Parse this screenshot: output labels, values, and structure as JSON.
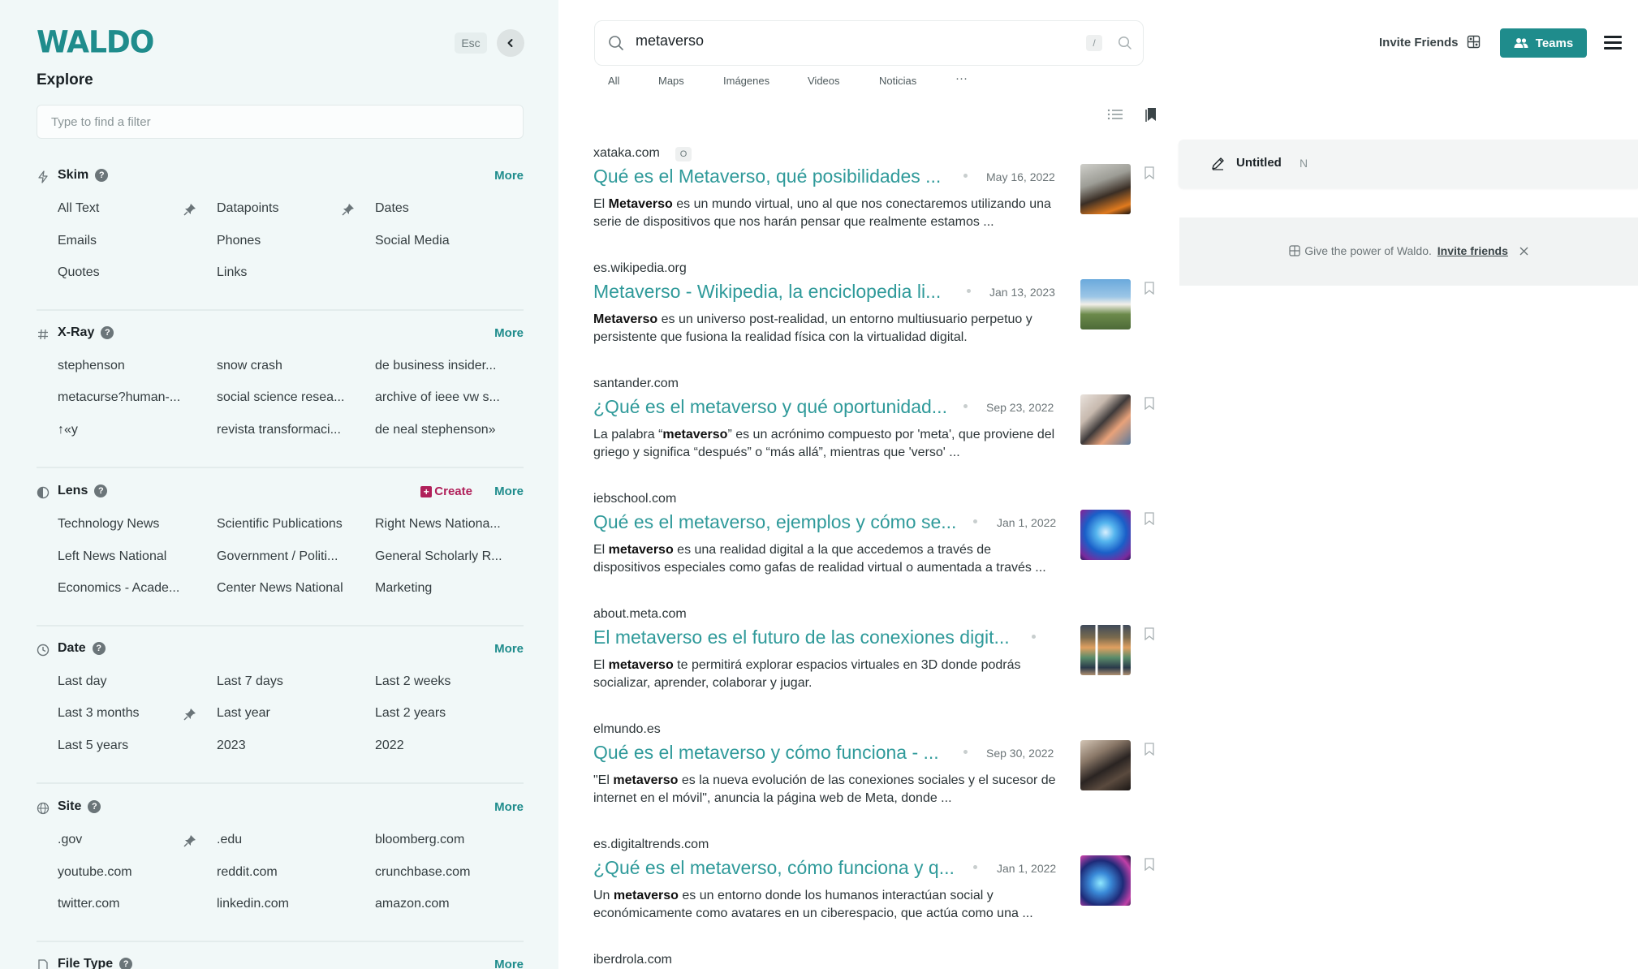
{
  "sidebar": {
    "logo": "WALDO",
    "esc_label": "Esc",
    "explore_title": "Explore",
    "filter_placeholder": "Type to find a filter",
    "more_label": "More",
    "create_label": "Create",
    "sections": {
      "skim": {
        "title": "Skim",
        "items": [
          "All Text",
          "Datapoints",
          "Dates",
          "Emails",
          "Phones",
          "Social Media",
          "Quotes",
          "Links"
        ]
      },
      "xray": {
        "title": "X-Ray",
        "items": [
          "stephenson",
          "snow crash",
          "de business insider...",
          "metacurse?human-...",
          "social science resea...",
          "archive of ieee vw s...",
          "↑«y",
          "revista transformaci...",
          "de neal stephenson»"
        ]
      },
      "lens": {
        "title": "Lens",
        "items": [
          "Technology News",
          "Scientific Publications",
          "Right News Nationa...",
          "Left News National",
          "Government / Politi...",
          "General Scholarly R...",
          "Economics - Acade...",
          "Center News National",
          "Marketing"
        ]
      },
      "date": {
        "title": "Date",
        "items": [
          "Last day",
          "Last 7 days",
          "Last 2 weeks",
          "Last 3 months",
          "Last year",
          "Last 2 years",
          "Last 5 years",
          "2023",
          "2022"
        ]
      },
      "site": {
        "title": "Site",
        "items": [
          ".gov",
          ".edu",
          "bloomberg.com",
          "youtube.com",
          "reddit.com",
          "crunchbase.com",
          "twitter.com",
          "linkedin.com",
          "amazon.com"
        ]
      },
      "filetype": {
        "title": "File Type"
      }
    }
  },
  "search": {
    "query": "metaverso",
    "shortcut": "/",
    "tabs": [
      "All",
      "Maps",
      "Imágenes",
      "Videos",
      "Noticias",
      "···"
    ]
  },
  "results": [
    {
      "domain": "xataka.com",
      "badge": "O",
      "title": "Qué es el Metaverso, qué posibilidades ...",
      "date": "May 16, 2022",
      "snippet_pre": "El ",
      "snippet_bold": "Metaverso",
      "snippet_post": " es un mundo virtual, uno al que nos conectaremos utilizando una serie de dispositivos que nos harán pensar que realmente estamos ..."
    },
    {
      "domain": "es.wikipedia.org",
      "title": "Metaverso - Wikipedia, la enciclopedia li...",
      "date": "Jan 13, 2023",
      "snippet_pre": "",
      "snippet_bold": "Metaverso",
      "snippet_post": " es un universo post-realidad, un entorno multiusuario perpetuo y persistente que fusiona la realidad física con la virtualidad digital."
    },
    {
      "domain": "santander.com",
      "title": "¿Qué es el metaverso y qué oportunidad...",
      "date": "Sep 23, 2022",
      "snippet_pre": "La palabra “",
      "snippet_bold": "metaverso",
      "snippet_post": "” es un acrónimo compuesto por 'meta', que proviene del griego y significa “después” o “más allá”, mientras que 'verso' ..."
    },
    {
      "domain": "iebschool.com",
      "title": "Qué es el metaverso, ejemplos y cómo se...",
      "date": "Jan 1, 2022",
      "snippet_pre": "El ",
      "snippet_bold": "metaverso",
      "snippet_post": " es una realidad digital a la que accedemos a través de dispositivos especiales como gafas de realidad virtual o aumentada a través ..."
    },
    {
      "domain": "about.meta.com",
      "title": "El metaverso es el futuro de las conexiones digit...",
      "date": "",
      "snippet_pre": "El ",
      "snippet_bold": "metaverso",
      "snippet_post": " te permitirá explorar espacios virtuales en 3D donde podrás socializar, aprender, colaborar y jugar."
    },
    {
      "domain": "elmundo.es",
      "title": "Qué es el metaverso y cómo funciona - ...",
      "date": "Sep 30, 2022",
      "snippet_pre": "\"El ",
      "snippet_bold": "metaverso",
      "snippet_post": " es la nueva evolución de las conexiones sociales y el sucesor de internet en el móvil\", anuncia la página web de Meta, donde ..."
    },
    {
      "domain": "es.digitaltrends.com",
      "title": "¿Qué es el metaverso, cómo funciona y q...",
      "date": "Jan 1, 2022",
      "snippet_pre": "Un ",
      "snippet_bold": "metaverso",
      "snippet_post": " es un entorno donde los humanos interactúan social y económicamente como avatares en un ciberespacio, que actúa como una ..."
    },
    {
      "domain": "iberdrola.com"
    }
  ],
  "header": {
    "invite_label": "Invite Friends",
    "teams_label": "Teams"
  },
  "panel": {
    "untitled_label": "Untitled",
    "shortcut_n": "N",
    "promo_text": "Give the power of Waldo.",
    "promo_link": "Invite friends"
  },
  "colors": {
    "brand": "#1f8c8c",
    "link": "#2f9a9a",
    "create": "#b0205a",
    "sidebar_bg": "#f1f8f8"
  }
}
